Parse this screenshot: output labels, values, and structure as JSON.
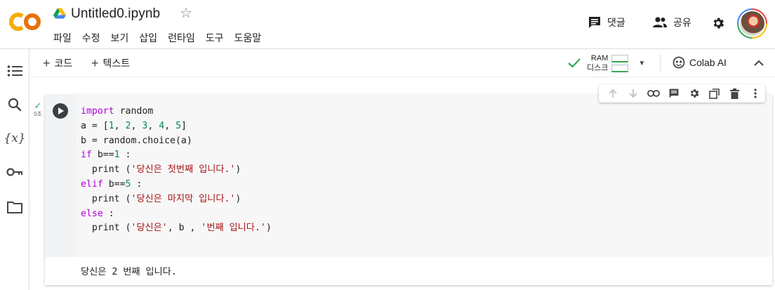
{
  "header": {
    "file_name": "Untitled0.ipynb",
    "menu": [
      "파일",
      "수정",
      "보기",
      "삽입",
      "런타임",
      "도구",
      "도움말"
    ],
    "comment_label": "댓글",
    "share_label": "공유"
  },
  "toolbar": {
    "add_code_label": "코드",
    "add_text_label": "텍스트",
    "ram_label": "RAM",
    "disk_label": "디스크",
    "colab_ai_label": "Colab AI"
  },
  "cell": {
    "exec_time": "0초",
    "code_lines": [
      "import random",
      "a = [1, 2, 3, 4, 5]",
      "b = random.choice(a)",
      "if b==1 :",
      "  print ('당신은 첫번째 입니다.')",
      "elif b==5 :",
      "  print ('당신은 마지막 입니다.')",
      "else :",
      "  print ('당신은', b , '번째 입니다.')"
    ],
    "output": "당신은 2 번째 입니다."
  },
  "colors": {
    "keyword": "#af00db",
    "number": "#098658",
    "string": "#a31515",
    "logo_orange": "#f9ab00",
    "run_check": "#34a853"
  }
}
